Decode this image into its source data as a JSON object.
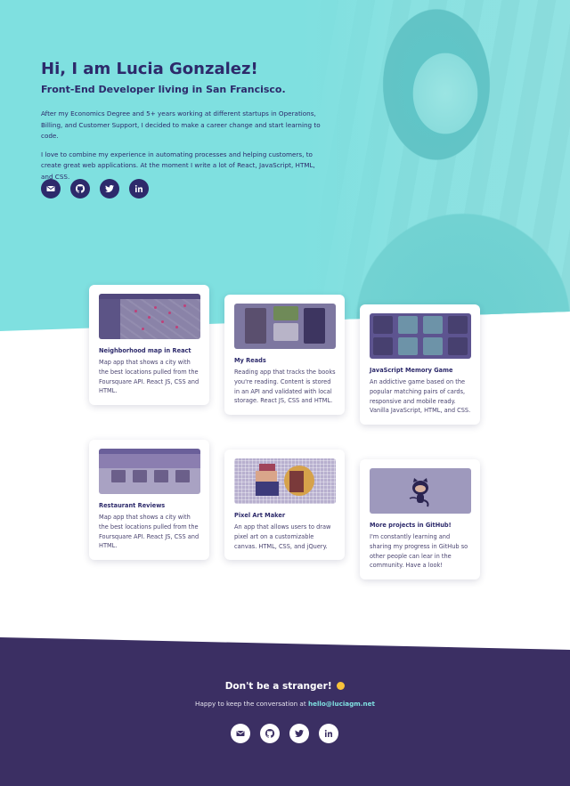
{
  "hero": {
    "title": "Hi, I am Lucia Gonzalez!",
    "subtitle": "Front-End Developer living in San Francisco.",
    "paragraphs": [
      "After my Economics Degree and 5+ years working at different startups in Operations, Billing, and Customer Support, I decided to make a career change and start learning to code.",
      "I love to combine my experience in automating processes and helping customers, to create great web applications. At the moment I write a lot of React, JavaScript, HTML, and CSS."
    ],
    "background_color": "#7fe0e0"
  },
  "social_icons": [
    "mail-icon",
    "github-icon",
    "twitter-icon",
    "linkedin-icon"
  ],
  "projects": [
    {
      "title": "Neighborhood map in React",
      "description": "Map app that shows a city with the best locations pulled from the Foursquare API. React JS, CSS and HTML."
    },
    {
      "title": "My Reads",
      "description": "Reading app that tracks the books you're reading. Content is stored in an API and validated with local storage. React JS, CSS and HTML."
    },
    {
      "title": "JavaScript Memory Game",
      "description": "An addictive game based on the popular matching pairs of cards, responsive and mobile ready. Vanilla JavaScript, HTML, and CSS."
    },
    {
      "title": "Restaurant Reviews",
      "description": "Map app that shows a city with the best locations pulled from the Foursquare API. React JS, CSS and HTML."
    },
    {
      "title": "Pixel Art Maker",
      "description": "An app that allows users to draw pixel art on a customizable canvas. HTML, CSS, and jQuery."
    },
    {
      "title": "More projects in GitHub!",
      "description": "I'm constantly learning and sharing my progress in GitHub so other people can lear in the community. Have a look!"
    }
  ],
  "footer": {
    "heading": "Don't be a stranger!",
    "text": "Happy to keep the conversation at",
    "email": "hello@luciagm.net",
    "background_color": "#3b2f63"
  }
}
